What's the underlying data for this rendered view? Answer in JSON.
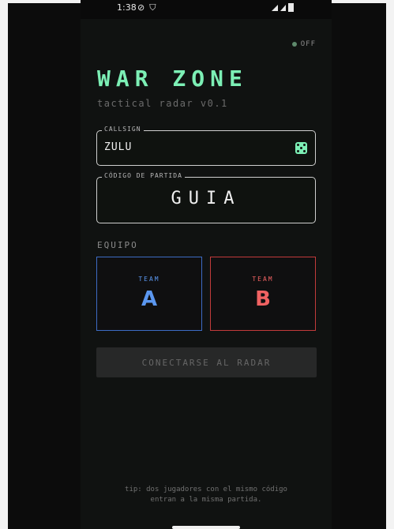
{
  "status_bar": {
    "time": "1:38",
    "icons": [
      "alarm-off-icon",
      "shield-icon",
      "wifi-icon",
      "signal-icon",
      "battery-icon"
    ]
  },
  "connection": {
    "label": "OFF",
    "color": "#5e8a6c"
  },
  "app": {
    "title": "WAR ZONE",
    "subtitle": "tactical radar v0.1"
  },
  "callsign": {
    "label": "CALLSIGN",
    "value": "ZULU",
    "button_icon": "dice-icon"
  },
  "game_code": {
    "label": "CÓDIGO DE PARTIDA",
    "value": "GUIA"
  },
  "team_select": {
    "label": "EQUIPO",
    "teams": [
      {
        "small": "TEAM",
        "letter": "A",
        "color": "#5b97f0"
      },
      {
        "small": "TEAM",
        "letter": "B",
        "color": "#f06262"
      }
    ]
  },
  "connect_button": {
    "label": "CONECTARSE AL RADAR"
  },
  "tip": {
    "line1": "tip: dos jugadores con el mismo código",
    "line2": "entran a la misma partida."
  },
  "colors": {
    "accent": "#7cefb5",
    "background": "#101211"
  }
}
